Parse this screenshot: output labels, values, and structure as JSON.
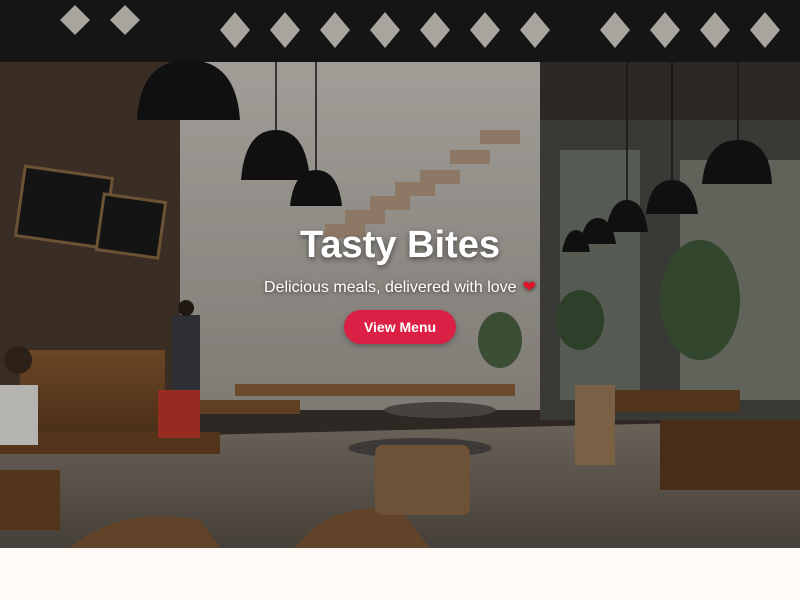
{
  "hero": {
    "title": "Tasty Bites",
    "subtitle": "Delicious meals, delivered with love",
    "subtitle_icon": "heart-icon",
    "cta_label": "View Menu"
  },
  "colors": {
    "accent": "#dc1f45",
    "heart": "#e0112b",
    "page_background": "#fffaf5"
  }
}
